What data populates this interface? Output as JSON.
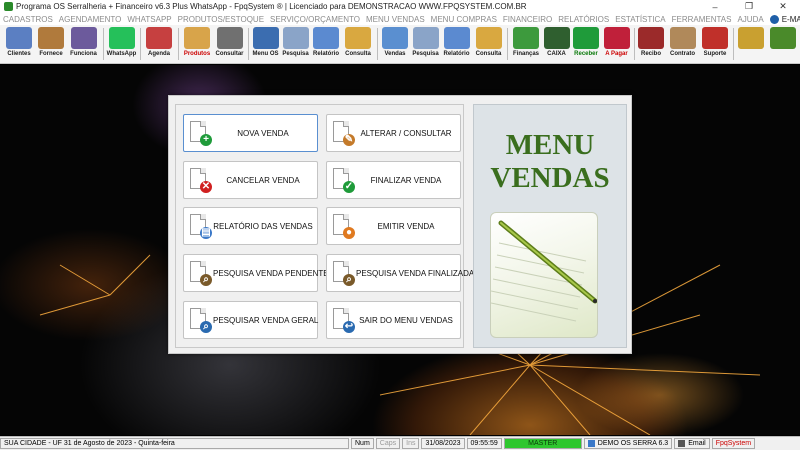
{
  "window": {
    "title": "Programa OS Serralheria + Financeiro v6.3 Plus WhatsApp - FpqSystem ® | Licenciado para  DEMONSTRACAO WWW.FPQSYSTEM.COM.BR",
    "minimize": "–",
    "restore": "❐",
    "close": "✕"
  },
  "menubar": {
    "items": [
      "CADASTROS",
      "AGENDAMENTO",
      "WHATSAPP",
      "PRODUTOS/ESTOQUE",
      "SERVIÇO/ORÇAMENTO",
      "MENU VENDAS",
      "MENU COMPRAS",
      "FINANCEIRO",
      "RELATÓRIOS",
      "ESTATÍSTICA",
      "FERRAMENTAS",
      "AJUDA"
    ],
    "email": "E-MAIL"
  },
  "toolbar": {
    "buttons": [
      {
        "label": "Clientes",
        "icon": "clients-icon",
        "color": "#5b7fc2"
      },
      {
        "label": "Fornece",
        "icon": "suppliers-icon",
        "color": "#b07a3c"
      },
      {
        "label": "Funciona",
        "icon": "employees-icon",
        "color": "#6c5a9c"
      },
      {
        "label": "WhatsApp",
        "icon": "whatsapp-icon",
        "color": "#25c05a"
      },
      {
        "label": "Agenda",
        "icon": "calendar-icon",
        "color": "#c64040"
      },
      {
        "label": "Produtos",
        "icon": "products-icon",
        "color": "#d8a44a"
      },
      {
        "label": "Consultar",
        "icon": "search-products-icon",
        "color": "#707070"
      },
      {
        "label": "Menu OS",
        "icon": "service-order-icon",
        "color": "#3b6db0"
      },
      {
        "label": "Pesquisa",
        "icon": "search-os-icon",
        "color": "#8aa4c8"
      },
      {
        "label": "Relatório",
        "icon": "report-os-icon",
        "color": "#5b8ad0"
      },
      {
        "label": "Consulta",
        "icon": "folder-os-icon",
        "color": "#d9a840"
      },
      {
        "label": "Vendas",
        "icon": "sales-monitor-icon",
        "color": "#5a8fd0"
      },
      {
        "label": "Pesquisa",
        "icon": "search-sales-icon",
        "color": "#8aa4c8"
      },
      {
        "label": "Relatório",
        "icon": "report-sales-icon",
        "color": "#5b8ad0"
      },
      {
        "label": "Consulta",
        "icon": "folder-sales-icon",
        "color": "#d9a840"
      },
      {
        "label": "Finanças",
        "icon": "finance-icon",
        "color": "#3d9a3d"
      },
      {
        "label": "CAIXA",
        "icon": "cashier-icon",
        "color": "#2f5f2f"
      },
      {
        "label": "Receber",
        "icon": "receive-money-icon",
        "color": "#1f9b3a"
      },
      {
        "label": "A Pagar",
        "icon": "pay-money-icon",
        "color": "#c0203a"
      },
      {
        "label": "Recibo",
        "icon": "receipt-icon",
        "color": "#9b2a2a"
      },
      {
        "label": "Contrato",
        "icon": "contract-icon",
        "color": "#b0895a"
      },
      {
        "label": "Suporte",
        "icon": "support-icon",
        "color": "#c0302a"
      },
      {
        "label": "",
        "icon": "settings-icon",
        "color": "#c9a030"
      },
      {
        "label": "",
        "icon": "exit-icon",
        "color": "#4a8a2a"
      }
    ]
  },
  "panel": {
    "buttons": [
      {
        "label": "NOVA VENDA",
        "icon": "new-sale-icon",
        "badge": "+",
        "badge_color": "#1f9b3a"
      },
      {
        "label": "ALTERAR / CONSULTAR",
        "icon": "edit-sale-icon",
        "badge": "✎",
        "badge_color": "#c47a2a"
      },
      {
        "label": "CANCELAR VENDA",
        "icon": "cancel-sale-icon",
        "badge": "✕",
        "badge_color": "#d02020"
      },
      {
        "label": "FINALIZAR VENDA",
        "icon": "finalize-sale-icon",
        "badge": "✓",
        "badge_color": "#1f9b3a"
      },
      {
        "label": "RELATÓRIO DAS VENDAS",
        "icon": "sales-report-icon",
        "badge": "▤",
        "badge_color": "#3a78c8"
      },
      {
        "label": "EMITIR VENDA",
        "icon": "issue-sale-icon",
        "badge": "●",
        "badge_color": "#e07a20"
      },
      {
        "label": "PESQUISA VENDA PENDENTE",
        "icon": "search-pending-icon",
        "badge": "⌕",
        "badge_color": "#7a5a2a"
      },
      {
        "label": "PESQUISA VENDA FINALIZADA",
        "icon": "search-finalized-icon",
        "badge": "⌕",
        "badge_color": "#7a5a2a"
      },
      {
        "label": "PESQUISAR VENDA GERAL",
        "icon": "search-general-icon",
        "badge": "⌕",
        "badge_color": "#2a6ab0"
      },
      {
        "label": "SAIR DO MENU VENDAS",
        "icon": "exit-menu-icon",
        "badge": "↩",
        "badge_color": "#2a6ab0"
      }
    ],
    "title_line1": "MENU",
    "title_line2": "VENDAS"
  },
  "statusbar": {
    "city": "SUA CIDADE - UF  31 de Agosto de 2023 - Quinta-feira",
    "num": "Num",
    "caps": "Caps",
    "ins": "Ins",
    "date": "31/08/2023",
    "time": "09:55:59",
    "master": "MASTER",
    "demo": "DEMO OS SERRA 6.3",
    "email": "Email",
    "brand": "FpqSystem"
  }
}
